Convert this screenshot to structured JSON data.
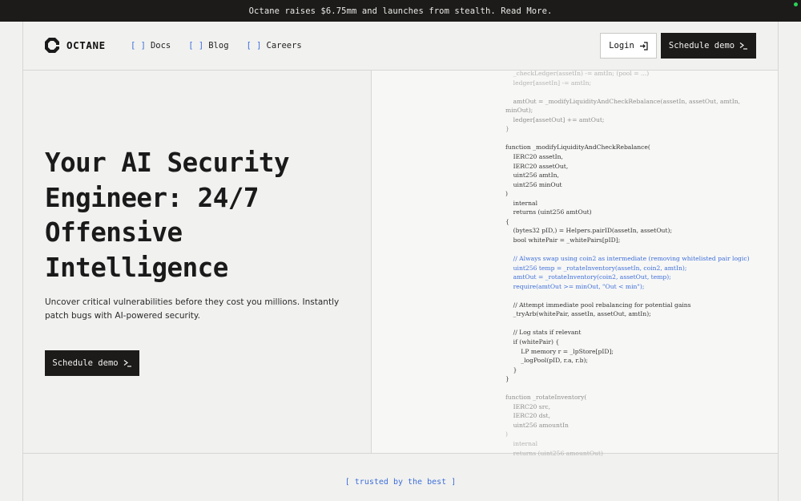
{
  "announcement": {
    "text": "Octane raises $6.75mm and launches from stealth. Read More."
  },
  "nav": {
    "brand": "OCTANE",
    "links": [
      {
        "bracket": "[ ]",
        "label": "Docs"
      },
      {
        "bracket": "[ ]",
        "label": "Blog"
      },
      {
        "bracket": "[ ]",
        "label": "Careers"
      }
    ],
    "login_label": "Login",
    "demo_label": "Schedule demo"
  },
  "hero": {
    "title_lines": [
      "Your AI Security",
      "Engineer: 24/7",
      "Offensive",
      "Intelligence"
    ],
    "subtitle": "Uncover critical vulnerabilities before they cost you millions. Instantly patch bugs with AI-powered security.",
    "cta_label": "Schedule demo"
  },
  "code": {
    "lines": [
      {
        "text": "    _checkLedger(assetIn) -= amtIn; (pool = ...)",
        "style": "fade"
      },
      {
        "text": "    ledger[assetIn] -= amtIn;",
        "style": "fade"
      },
      {
        "text": "",
        "style": "fade"
      },
      {
        "text": "    amtOut = _modifyLiquidityAndCheckRebalance(assetIn, assetOut, amtIn,",
        "style": "med"
      },
      {
        "text": "minOut);",
        "style": "med"
      },
      {
        "text": "    ledger[assetOut] += amtOut;",
        "style": "med"
      },
      {
        "text": "}",
        "style": "med"
      },
      {
        "text": "",
        "style": "normal"
      },
      {
        "text": "function _modifyLiquidityAndCheckRebalance(",
        "style": "normal"
      },
      {
        "text": "    IERC20 assetIn,",
        "style": "normal"
      },
      {
        "text": "    IERC20 assetOut,",
        "style": "normal"
      },
      {
        "text": "    uint256 amtIn,",
        "style": "normal"
      },
      {
        "text": "    uint256 minOut",
        "style": "normal"
      },
      {
        "text": ")",
        "style": "normal"
      },
      {
        "text": "    internal",
        "style": "normal"
      },
      {
        "text": "    returns (uint256 amtOut)",
        "style": "normal"
      },
      {
        "text": "{",
        "style": "normal"
      },
      {
        "text": "    (bytes32 pID,) = Helpers.pairID(assetIn, assetOut);",
        "style": "normal"
      },
      {
        "text": "    bool whitePair = _whitePairs[pID];",
        "style": "normal"
      },
      {
        "text": "",
        "style": "normal"
      },
      {
        "text": "    // Always swap using coin2 as intermediate (removing whitelisted pair logic)",
        "style": "blue"
      },
      {
        "text": "    uint256 temp = _rotateInventory(assetIn, coin2, amtIn);",
        "style": "blue"
      },
      {
        "text": "    amtOut = _rotateInventory(coin2, assetOut, temp);",
        "style": "blue"
      },
      {
        "text": "    require(amtOut >= minOut, \"Out < min\");",
        "style": "blue"
      },
      {
        "text": "",
        "style": "normal"
      },
      {
        "text": "    // Attempt immediate pool rebalancing for potential gains",
        "style": "normal"
      },
      {
        "text": "    _tryArb(whitePair, assetIn, assetOut, amtIn);",
        "style": "normal"
      },
      {
        "text": "",
        "style": "normal"
      },
      {
        "text": "    // Log stats if relevant",
        "style": "normal"
      },
      {
        "text": "    if (whitePair) {",
        "style": "normal"
      },
      {
        "text": "        LP memory r = _lpStore[pID];",
        "style": "normal"
      },
      {
        "text": "        _logPool(pID, r.a, r.b);",
        "style": "normal"
      },
      {
        "text": "    }",
        "style": "normal"
      },
      {
        "text": "}",
        "style": "normal"
      },
      {
        "text": "",
        "style": "normal"
      },
      {
        "text": "function _rotateInventory(",
        "style": "med"
      },
      {
        "text": "    IERC20 src,",
        "style": "med"
      },
      {
        "text": "    IERC20 dst,",
        "style": "med"
      },
      {
        "text": "    uint256 amountIn",
        "style": "med"
      },
      {
        "text": ")",
        "style": "fade"
      },
      {
        "text": "    internal",
        "style": "fade"
      },
      {
        "text": "    returns (uint256 amountOut)",
        "style": "fade"
      }
    ]
  },
  "trusted": {
    "label": "[ trusted by the best ]"
  },
  "icons": {
    "logo": "octagon-logo-icon",
    "login": "login-arrow-icon",
    "terminal": "terminal-prompt-icon"
  },
  "colors": {
    "accent_blue": "#3e6fd8",
    "dark": "#1c1b19",
    "background": "#f1f1f0",
    "status_dot": "#2bd35a"
  }
}
